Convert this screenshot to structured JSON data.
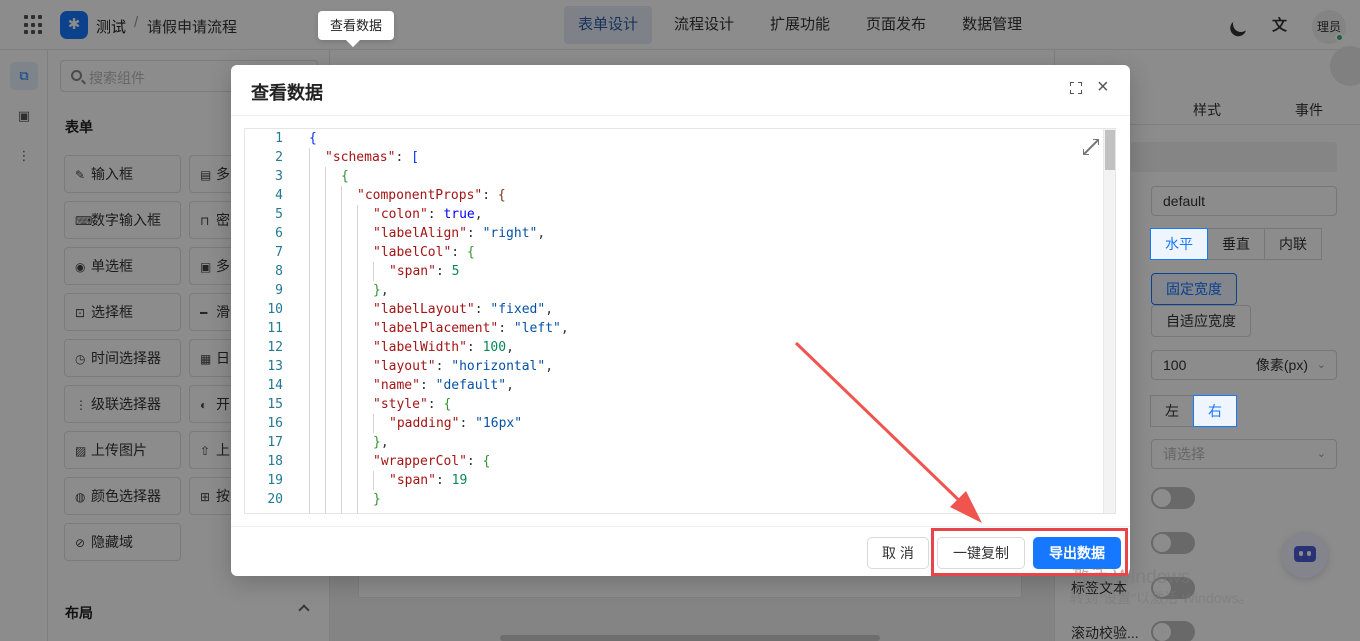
{
  "header": {
    "app_name": "测试",
    "separator": "/",
    "page_name": "请假申请流程",
    "tabs": [
      "表单设计",
      "流程设计",
      "扩展功能",
      "页面发布",
      "数据管理"
    ],
    "active_tab": "表单设计",
    "translate_glyph": "文",
    "user": "理员"
  },
  "components": {
    "search_placeholder": "搜索组件",
    "form_section_title": "表单",
    "items_col1": [
      "输入框",
      "数字输入框",
      "单选框",
      "选择框",
      "时间选择器",
      "级联选择器",
      "上传图片",
      "颜色选择器",
      "隐藏域"
    ],
    "items_col2": [
      "多",
      "密",
      "多",
      "滑",
      "日",
      "开",
      "上",
      "按"
    ],
    "layout_section_title": "布局"
  },
  "right_panel": {
    "tab_style": "样式",
    "tab_event": "事件",
    "name_value": "default",
    "layout_options": [
      "水平",
      "垂直",
      "内联"
    ],
    "layout_selected": "水平",
    "width_mode_fixed": "固定宽度",
    "width_mode_auto": "自适应宽度",
    "label_width_value": "100",
    "label_width_unit": "像素(px)",
    "align_options": [
      "左",
      "右"
    ],
    "align_selected": "右",
    "select_placeholder": "请选择",
    "label_text_label": "标签文本",
    "scroll_validate_label": "滚动校验..."
  },
  "watermark": {
    "line1": "激活 Windows",
    "line2": "转到\"设置\"以激活 Windows。"
  },
  "tooltip": "查看数据",
  "modal": {
    "title": "查看数据",
    "buttons": {
      "cancel": "取 消",
      "copy": "一键复制",
      "export": "导出数据"
    },
    "code_lines": [
      [
        [
          "b",
          "{"
        ]
      ],
      [
        [
          "k",
          "\"schemas\""
        ],
        [
          "p",
          ": "
        ],
        [
          "b",
          "["
        ]
      ],
      [
        [
          "p",
          "{"
        ]
      ],
      [
        [
          "k",
          "\"componentProps\""
        ],
        [
          "p",
          ": "
        ],
        [
          "b",
          "{"
        ]
      ],
      [
        [
          "k",
          "\"colon\""
        ],
        [
          "p",
          ": "
        ],
        [
          "bool",
          "true"
        ],
        [
          "p",
          ","
        ]
      ],
      [
        [
          "k",
          "\"labelAlign\""
        ],
        [
          "p",
          ": "
        ],
        [
          "s",
          "\"right\""
        ],
        [
          "p",
          ","
        ]
      ],
      [
        [
          "k",
          "\"labelCol\""
        ],
        [
          "p",
          ": "
        ],
        [
          "g",
          "{"
        ]
      ],
      [
        [
          "k",
          "\"span\""
        ],
        [
          "p",
          ": "
        ],
        [
          "n",
          "5"
        ]
      ],
      [
        [
          "g",
          "}"
        ],
        [
          "p",
          ","
        ]
      ],
      [
        [
          "k",
          "\"labelLayout\""
        ],
        [
          "p",
          ": "
        ],
        [
          "s",
          "\"fixed\""
        ],
        [
          "p",
          ","
        ]
      ],
      [
        [
          "k",
          "\"labelPlacement\""
        ],
        [
          "p",
          ": "
        ],
        [
          "s",
          "\"left\""
        ],
        [
          "p",
          ","
        ]
      ],
      [
        [
          "k",
          "\"labelWidth\""
        ],
        [
          "p",
          ": "
        ],
        [
          "n",
          "100"
        ],
        [
          "p",
          ","
        ]
      ],
      [
        [
          "k",
          "\"layout\""
        ],
        [
          "p",
          ": "
        ],
        [
          "s",
          "\"horizontal\""
        ],
        [
          "p",
          ","
        ]
      ],
      [
        [
          "k",
          "\"name\""
        ],
        [
          "p",
          ": "
        ],
        [
          "s",
          "\"default\""
        ],
        [
          "p",
          ","
        ]
      ],
      [
        [
          "k",
          "\"style\""
        ],
        [
          "p",
          ": "
        ],
        [
          "g",
          "{"
        ]
      ],
      [
        [
          "k",
          "\"padding\""
        ],
        [
          "p",
          ": "
        ],
        [
          "s",
          "\"16px\""
        ]
      ],
      [
        [
          "g",
          "}"
        ],
        [
          "p",
          ","
        ]
      ],
      [
        [
          "k",
          "\"wrapperCol\""
        ],
        [
          "p",
          ": "
        ],
        [
          "g",
          "{"
        ]
      ],
      [
        [
          "k",
          "\"span\""
        ],
        [
          "p",
          ": "
        ],
        [
          "n",
          "19"
        ]
      ],
      [
        [
          "g",
          "}"
        ]
      ]
    ]
  }
}
